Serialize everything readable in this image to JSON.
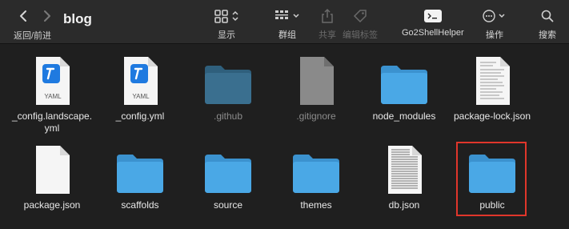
{
  "window": {
    "title": "blog"
  },
  "nav": {
    "back_forward_label": "返回/前进"
  },
  "toolbar": {
    "view_label": "显示",
    "group_label": "群组",
    "share_label": "共享",
    "tags_label": "编辑标签",
    "go2shell_label": "Go2ShellHelper",
    "action_label": "操作",
    "search_label": "搜索"
  },
  "files": {
    "row1": [
      {
        "name": "_config.landscape.yml",
        "kind": "yaml",
        "badge": "YAML"
      },
      {
        "name": "_config.yml",
        "kind": "yaml",
        "badge": "YAML"
      },
      {
        "name": ".github",
        "kind": "folder-dim"
      },
      {
        "name": ".gitignore",
        "kind": "doc-dim"
      },
      {
        "name": "node_modules",
        "kind": "folder"
      },
      {
        "name": "package-lock.json",
        "kind": "doc-text"
      }
    ],
    "row2": [
      {
        "name": "package.json",
        "kind": "doc-blank"
      },
      {
        "name": "scaffolds",
        "kind": "folder"
      },
      {
        "name": "source",
        "kind": "folder"
      },
      {
        "name": "themes",
        "kind": "folder"
      },
      {
        "name": "db.json",
        "kind": "doc-text"
      },
      {
        "name": "public",
        "kind": "folder",
        "selected": true
      }
    ]
  },
  "colors": {
    "folder": "#4aa8e6",
    "folder_dim": "#3a6f8f",
    "highlight_border": "#e0362b",
    "yaml_blue": "#1f7ae0"
  }
}
